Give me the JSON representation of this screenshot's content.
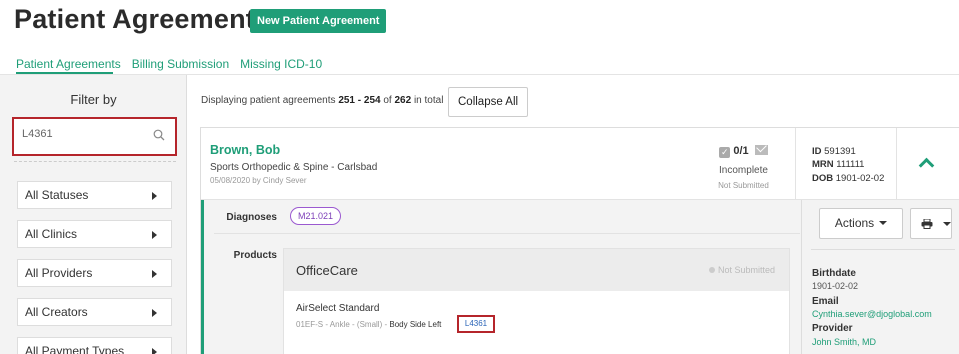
{
  "page": {
    "title": "Patient Agreements",
    "new_button": "New Patient Agreement"
  },
  "tabs": [
    "Patient Agreements",
    "Billing Submission",
    "Missing ICD-10"
  ],
  "sidebar": {
    "filter_title": "Filter by",
    "search_value": "L4361",
    "filters": [
      "All Statuses",
      "All Clinics",
      "All Providers",
      "All Creators",
      "All Payment Types"
    ]
  },
  "listing": {
    "display_prefix": "Displaying patient agreements ",
    "display_range": "251 - 254",
    "display_of": " of ",
    "display_total": "262",
    "display_suffix": " in total",
    "collapse_label": "Collapse All"
  },
  "agreement": {
    "patient_name": "Brown, Bob",
    "clinic": "Sports Orthopedic & Spine - Carlsbad",
    "created": "05/08/2020 by Cindy Sever",
    "count": "0/1",
    "status": "Incomplete",
    "submission": "Not Submitted",
    "id_label": "ID",
    "id_value": "591391",
    "mrn_label": "MRN",
    "mrn_value": "111111",
    "dob_label": "DOB",
    "dob_value": "1901-02-02",
    "diagnoses_label": "Diagnoses",
    "diagnosis_code": "M21.021",
    "products_label": "Products",
    "product": {
      "name": "OfficeCare",
      "status": "Not Submitted",
      "item_name": "AirSelect Standard",
      "item_detail": "01EF-S - Ankle - (Small) - ",
      "item_side": "Body Side Left",
      "item_code": "L4361"
    }
  },
  "details_panel": {
    "actions_label": "Actions",
    "birthdate_label": "Birthdate",
    "birthdate_value": "1901-02-02",
    "email_label": "Email",
    "email_value": "Cynthia.sever@djoglobal.com",
    "provider_label": "Provider",
    "provider_value": "John Smith, MD"
  },
  "colors": {
    "accent": "#1f9e78",
    "highlight_border": "#b5252b",
    "diagnosis_pill": "#9b59d0"
  }
}
